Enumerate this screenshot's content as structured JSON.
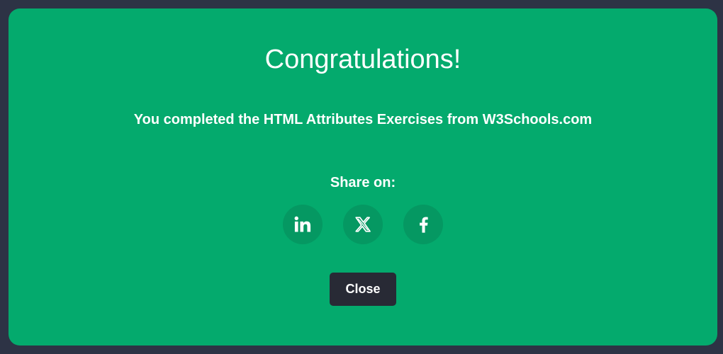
{
  "modal": {
    "title": "Congratulations!",
    "message": "You completed the HTML Attributes Exercises from W3Schools.com",
    "share_label": "Share on:",
    "share_buttons": [
      {
        "name": "LinkedIn",
        "icon": "linkedin-icon"
      },
      {
        "name": "X",
        "icon": "x-icon"
      },
      {
        "name": "Facebook",
        "icon": "facebook-icon"
      }
    ],
    "close_label": "Close"
  },
  "colors": {
    "backdrop": "#2d3345",
    "modal_background": "#04aa6d",
    "share_button_background": "#059862",
    "close_button_background": "#282a35",
    "text": "#ffffff"
  }
}
